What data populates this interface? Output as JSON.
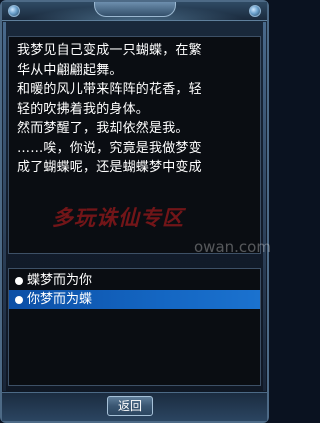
{
  "story": {
    "lines": [
      "我梦见自己变成一只蝴蝶，在繁",
      "华从中翩翩起舞。",
      "和暖的风儿带来阵阵的花香，轻",
      "轻的吹拂着我的身体。",
      "然而梦醒了，我却依然是我。",
      "……唉，你说，究竟是我做梦变",
      "成了蝴蝶呢，还是蝴蝶梦中变成"
    ]
  },
  "watermark": {
    "text": "多玩诛仙专区",
    "domain": "owan.com"
  },
  "options": [
    {
      "label": "蝶梦而为你",
      "selected": false
    },
    {
      "label": "你梦而为蝶",
      "selected": true
    }
  ],
  "footer": {
    "back_label": "返回"
  },
  "colors": {
    "selection": "#1466c2",
    "text": "#ffffff",
    "panel_bg": "#0a0d12",
    "frame": "#4d6a86",
    "watermark": "#c81e1e"
  }
}
